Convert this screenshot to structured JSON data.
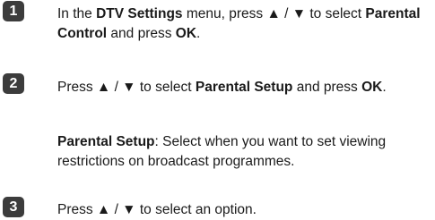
{
  "steps": [
    {
      "number": "1",
      "parts": [
        "In the ",
        "DTV Settings",
        " menu, press ▲ / ▼ to select ",
        "Parental Control",
        " and press ",
        "OK",
        "."
      ]
    },
    {
      "number": "2",
      "parts": [
        "Press ▲ / ▼ to select ",
        "Parental Setup",
        " and press ",
        "OK",
        "."
      ],
      "note": {
        "term": "Parental Setup",
        "text": ": Select when you want to set viewing restrictions on broadcast programmes."
      }
    },
    {
      "number": "3",
      "parts": [
        "Press ▲ / ▼ to select an option."
      ]
    }
  ]
}
